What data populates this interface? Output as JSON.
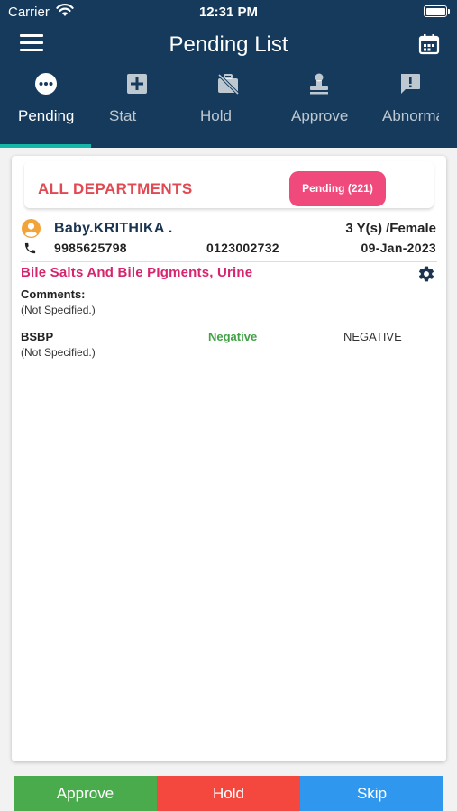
{
  "status_bar": {
    "carrier": "Carrier",
    "time": "12:31 PM"
  },
  "header": {
    "title": "Pending List",
    "menu_icon": "hamburger-menu-icon",
    "calendar_icon": "calendar-icon"
  },
  "tabs": [
    {
      "label": "Pending",
      "icon": "more-horizontal-circle-icon",
      "active": true
    },
    {
      "label": "Stat",
      "icon": "plus-box-icon",
      "active": false
    },
    {
      "label": "Hold",
      "icon": "briefcase-off-icon",
      "active": false
    },
    {
      "label": "Approve",
      "icon": "stamp-icon",
      "active": false
    },
    {
      "label": "Abnormal",
      "icon": "alert-message-icon",
      "active": false
    }
  ],
  "department": {
    "title": "ALL DEPARTMENTS",
    "pending_badge": "Pending (221)"
  },
  "patient": {
    "name": "Baby.KRITHIKA .",
    "age_gender": "3 Y(s) /Female",
    "phone": "9985625798",
    "sample_id": "0123002732",
    "date": "09-Jan-2023"
  },
  "test": {
    "name": "Bile Salts And Bile PIgments, Urine",
    "comments_label": "Comments:",
    "comments_value": "(Not Specified.)"
  },
  "parameter": {
    "name": "BSBP",
    "result": "Negative",
    "reference": "NEGATIVE",
    "comment": "(Not Specified.)"
  },
  "actions": {
    "approve": "Approve",
    "hold": "Hold",
    "skip": "Skip"
  },
  "colors": {
    "header_bg": "#153a5c",
    "tab_indicator": "#16b6a8",
    "department_title": "#e14a53",
    "pending_badge": "#f04a7c",
    "test_name": "#d6246e",
    "result_negative": "#43a148",
    "approve": "#4aab4d",
    "hold": "#f4473d",
    "skip": "#2f97ee"
  }
}
